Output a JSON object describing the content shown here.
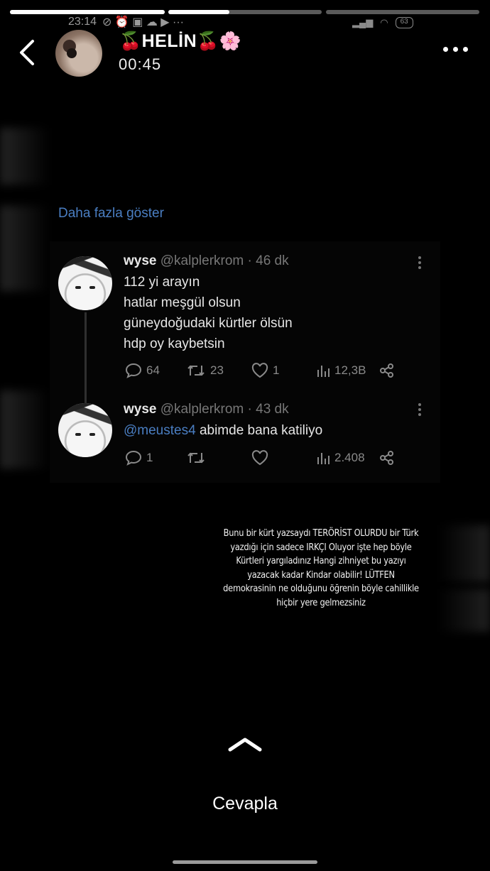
{
  "story": {
    "progress": [
      1.0,
      0.46,
      0.0
    ],
    "status_time": "23:14",
    "battery": "63",
    "user": {
      "name": "🍒HELİN🍒🌸",
      "time": "00:45"
    },
    "show_more": "Daha fazla göster",
    "tweets": [
      {
        "name": "wyse",
        "handle": "@kalplerkrom",
        "time": "· 46 dk",
        "lines": [
          "112 yi arayın",
          "hatlar meşgül olsun",
          "güneydoğudaki kürtler ölsün",
          "hdp oy kaybetsin"
        ],
        "replies": "64",
        "retweets": "23",
        "likes": "1",
        "views": "12,3B"
      },
      {
        "name": "wyse",
        "handle": "@kalplerkrom",
        "time": "· 43 dk",
        "mention": "@meustes4",
        "text": " abimde bana katiliyo",
        "replies": "1",
        "retweets": "",
        "likes": "",
        "views": "2.408"
      }
    ],
    "caption": "Bunu bir kürt yazsaydı TERÖRİST OLURDU bir Türk yazdığı için sadece IRKÇI Oluyor işte hep böyle Kürtleri yargıladınız Hangi zihniyet bu yazıyı yazacak kadar Kindar olabilir! LÜTFEN demokrasinin ne olduğunu öğrenin böyle cahillikle hiçbir yere gelmezsiniz",
    "reply_label": "Cevapla"
  }
}
